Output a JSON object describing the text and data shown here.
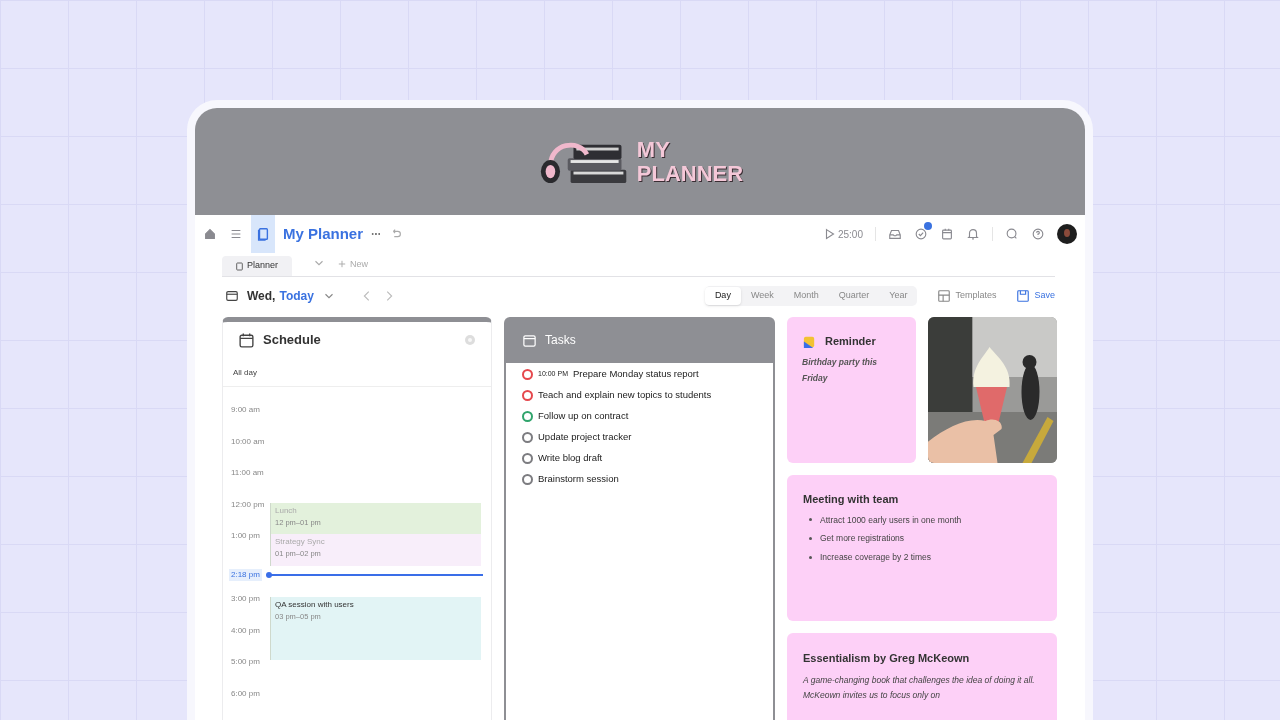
{
  "banner": {
    "title_lines": [
      "MY",
      "PLANNER"
    ]
  },
  "toolbar": {
    "title": "My Planner",
    "timer": "25:00"
  },
  "tabs": [
    {
      "label": "Planner",
      "selected": true
    }
  ],
  "new_tab": "New",
  "date": {
    "day": "Wed,",
    "relative": "Today"
  },
  "views": [
    {
      "label": "Day",
      "selected": true
    },
    {
      "label": "Week",
      "selected": false
    },
    {
      "label": "Month",
      "selected": false
    },
    {
      "label": "Quarter",
      "selected": false
    },
    {
      "label": "Year",
      "selected": false
    }
  ],
  "actions": {
    "templates": "Templates",
    "save": "Save"
  },
  "schedule": {
    "title": "Schedule",
    "all_day": "All day",
    "hours": [
      "9:00 am",
      "10:00 am",
      "11:00 am",
      "12:00 pm",
      "1:00 pm",
      "3:00 pm",
      "4:00 pm",
      "5:00 pm",
      "6:00 pm"
    ],
    "now": "2:18 pm",
    "events": [
      {
        "title": "Lunch",
        "time": "12 pm–01 pm",
        "color": "#e3f1dc"
      },
      {
        "title": "Strategy Sync",
        "time": "01 pm–02 pm",
        "color": "#f8eefa"
      },
      {
        "title": "QA session with users",
        "time": "03 pm–05 pm",
        "color": "#e2f4f5"
      }
    ]
  },
  "tasks": {
    "title": "Tasks",
    "items": [
      {
        "time": "10:00 PM",
        "label": "Prepare Monday status report",
        "color": "#e5484d"
      },
      {
        "label": "Teach and explain new topics to students",
        "color": "#e5484d"
      },
      {
        "label": "Follow up on contract",
        "color": "#30a46c"
      },
      {
        "label": "Update project tracker",
        "color": "#7c7c80"
      },
      {
        "label": "Write blog draft",
        "color": "#7c7c80"
      },
      {
        "label": "Brainstorm session",
        "color": "#7c7c80"
      }
    ]
  },
  "reminder": {
    "title": "Reminder",
    "text": "Birthday party this Friday"
  },
  "meeting": {
    "title": "Meeting with team",
    "bullets": [
      "Attract 1000 early users in one month",
      "Get more registrations",
      "Increase coverage by 2 times"
    ]
  },
  "book": {
    "title": "Essentialism by Greg McKeown",
    "text": "A game-changing book that challenges the idea of doing it all. McKeown invites us to focus only on"
  }
}
